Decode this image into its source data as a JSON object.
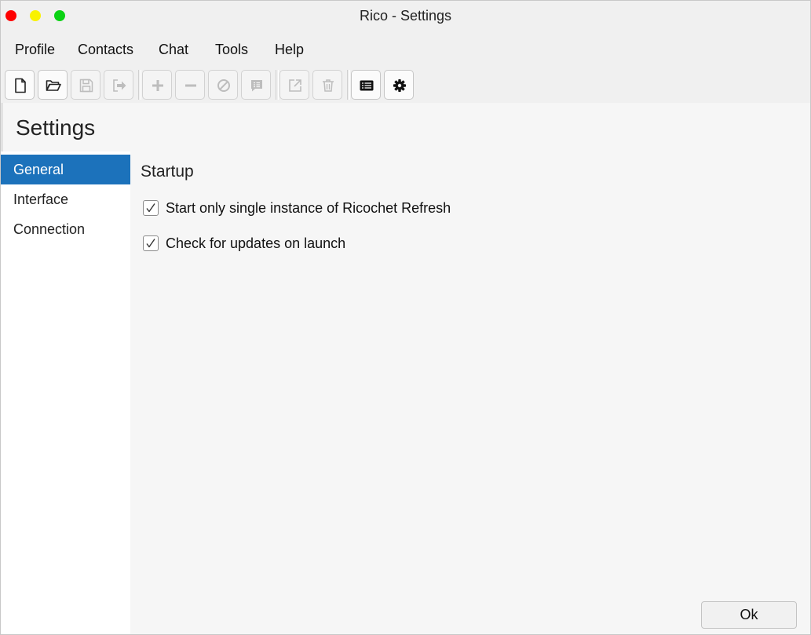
{
  "window": {
    "title": "Rico - Settings"
  },
  "menubar": {
    "items": [
      "Profile",
      "Contacts",
      "Chat",
      "Tools",
      "Help"
    ]
  },
  "toolbar": {
    "buttons": [
      {
        "icon": "new-file-icon",
        "enabled": true
      },
      {
        "icon": "open-folder-icon",
        "enabled": true
      },
      {
        "icon": "save-icon",
        "enabled": false
      },
      {
        "icon": "export-icon",
        "enabled": false
      },
      {
        "icon": "plus-icon",
        "enabled": false
      },
      {
        "icon": "minus-icon",
        "enabled": false
      },
      {
        "icon": "block-icon",
        "enabled": false
      },
      {
        "icon": "message-icon",
        "enabled": false
      },
      {
        "icon": "external-link-icon",
        "enabled": false
      },
      {
        "icon": "trash-icon",
        "enabled": false
      },
      {
        "icon": "list-icon",
        "enabled": true
      },
      {
        "icon": "gear-icon",
        "enabled": true
      }
    ]
  },
  "header": {
    "title": "Settings"
  },
  "sidebar": {
    "items": [
      {
        "label": "General",
        "selected": true
      },
      {
        "label": "Interface",
        "selected": false
      },
      {
        "label": "Connection",
        "selected": false
      }
    ]
  },
  "main": {
    "section_title": "Startup",
    "options": [
      {
        "label": "Start only single instance of Ricochet Refresh",
        "checked": true
      },
      {
        "label": "Check for updates on launch",
        "checked": true
      }
    ]
  },
  "footer": {
    "ok_label": "Ok"
  },
  "colors": {
    "accent": "#1c72bb",
    "close": "#fe0000",
    "minimize": "#f9f200",
    "maximize": "#0bd214"
  }
}
